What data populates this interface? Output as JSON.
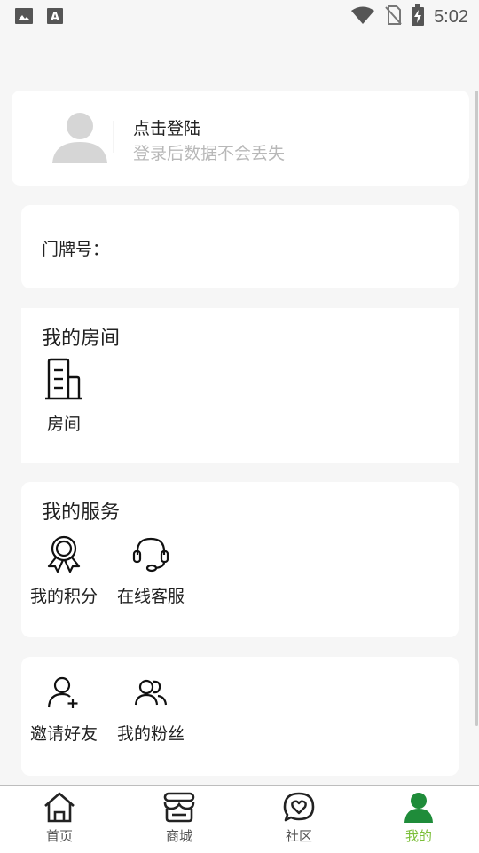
{
  "status_bar": {
    "time": "5:02",
    "left_icons": [
      "image-icon",
      "text-a-icon"
    ],
    "right_icons": [
      "wifi-icon",
      "no-sim-icon",
      "battery-charging-icon"
    ]
  },
  "profile": {
    "title": "点击登陆",
    "subtitle": "登录后数据不会丢失"
  },
  "door": {
    "label": "门牌号："
  },
  "rooms": {
    "title": "我的房间",
    "items": [
      {
        "label": "房间",
        "icon": "building-icon"
      }
    ]
  },
  "services": {
    "title": "我的服务",
    "items": [
      {
        "label": "我的积分",
        "icon": "award-icon"
      },
      {
        "label": "在线客服",
        "icon": "headset-icon"
      }
    ]
  },
  "social": {
    "items": [
      {
        "label": "邀请好友",
        "icon": "add-user-icon"
      },
      {
        "label": "我的粉丝",
        "icon": "users-icon"
      }
    ]
  },
  "bottom_nav": {
    "items": [
      {
        "label": "首页",
        "icon": "home-icon"
      },
      {
        "label": "商城",
        "icon": "store-icon"
      },
      {
        "label": "社区",
        "icon": "chat-heart-icon"
      },
      {
        "label": "我的",
        "icon": "person-icon",
        "active": true
      }
    ],
    "active_color": "#7cbf3a",
    "active_icon_color": "#1f8c3a"
  }
}
